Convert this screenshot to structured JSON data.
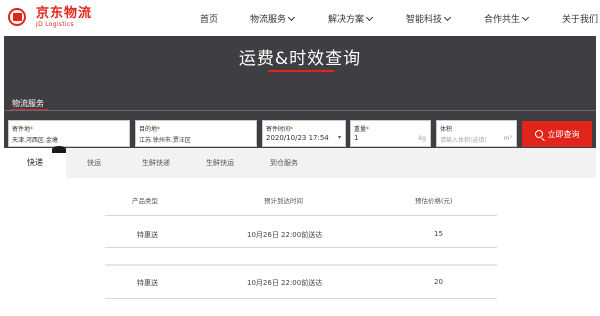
{
  "logo": {
    "cn": "京东物流",
    "en": "JD Logistics"
  },
  "nav": {
    "items": [
      {
        "label": "首页",
        "dropdown": false
      },
      {
        "label": "物流服务",
        "dropdown": true
      },
      {
        "label": "解决方案",
        "dropdown": true
      },
      {
        "label": "智能科技",
        "dropdown": true
      },
      {
        "label": "合作共生",
        "dropdown": true
      },
      {
        "label": "关于我们",
        "dropdown": false
      }
    ]
  },
  "hero": {
    "title": "运费&时效查询",
    "service_label": "物流服务"
  },
  "form": {
    "origin": {
      "label": "寄件地",
      "value": "天津.河西区.金塘"
    },
    "destination": {
      "label": "目的地",
      "value": "江苏.徐州市.贾汪区"
    },
    "time": {
      "label": "寄件时间",
      "value": "2020/10/23 17:54",
      "caret": "▾"
    },
    "weight": {
      "label": "重量",
      "value": "1",
      "unit": "kg"
    },
    "volume": {
      "label": "体积",
      "placeholder": "请输入体积(选填)",
      "unit": "m³"
    },
    "required_mark": "*",
    "submit_label": "立即查询"
  },
  "tabs": [
    "快递",
    "快运",
    "生鲜快递",
    "生鲜快运",
    "到仓服务"
  ],
  "results": {
    "headers": [
      "产品类型",
      "预计到达时间",
      "预估价格(元)"
    ],
    "rows": [
      {
        "product": "特惠送",
        "arrival": "10月26日 22:00前送达",
        "price": "15"
      },
      {
        "product": "特惠送",
        "arrival": "10月26日 22:00前送达",
        "price": "20"
      }
    ]
  },
  "colors": {
    "accent": "#e1251b",
    "hero_bg": "#3f3f43"
  }
}
